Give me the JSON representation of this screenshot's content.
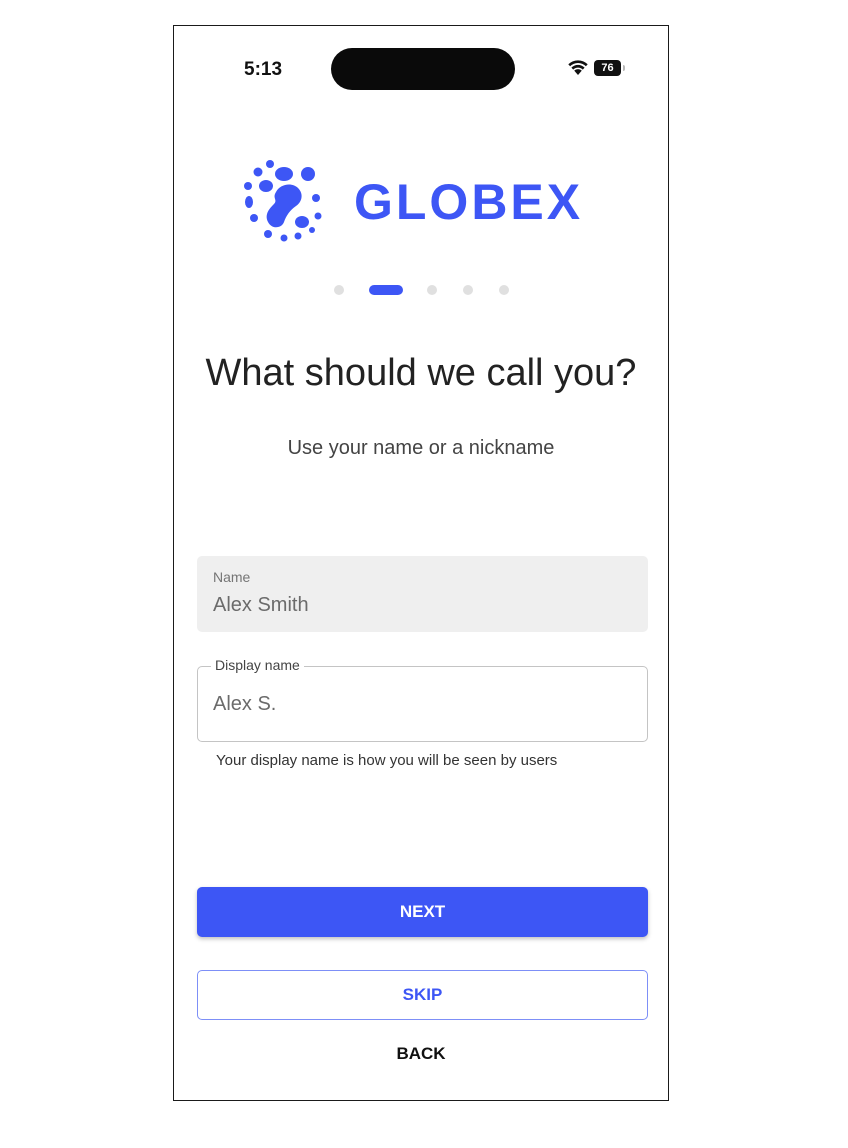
{
  "status_bar": {
    "time": "5:13",
    "battery_level": "76",
    "icons": [
      "wifi-icon",
      "battery-icon"
    ]
  },
  "brand": {
    "name": "GLOBEX",
    "color": "#3d56f5",
    "logo_icon": "globe-dots-icon"
  },
  "pager": {
    "total_steps": 5,
    "active_step": 2
  },
  "heading": "What should we call you?",
  "subheading": "Use your name or a nickname",
  "name_field": {
    "label": "Name",
    "value": "Alex Smith"
  },
  "display_name_field": {
    "label": "Display name",
    "value": "Alex S.",
    "helper": "Your display name is how you will be seen by users"
  },
  "buttons": {
    "next": "NEXT",
    "skip": "SKIP",
    "back": "BACK"
  },
  "colors": {
    "accent": "#3d56f5",
    "field_background": "#efefef"
  }
}
